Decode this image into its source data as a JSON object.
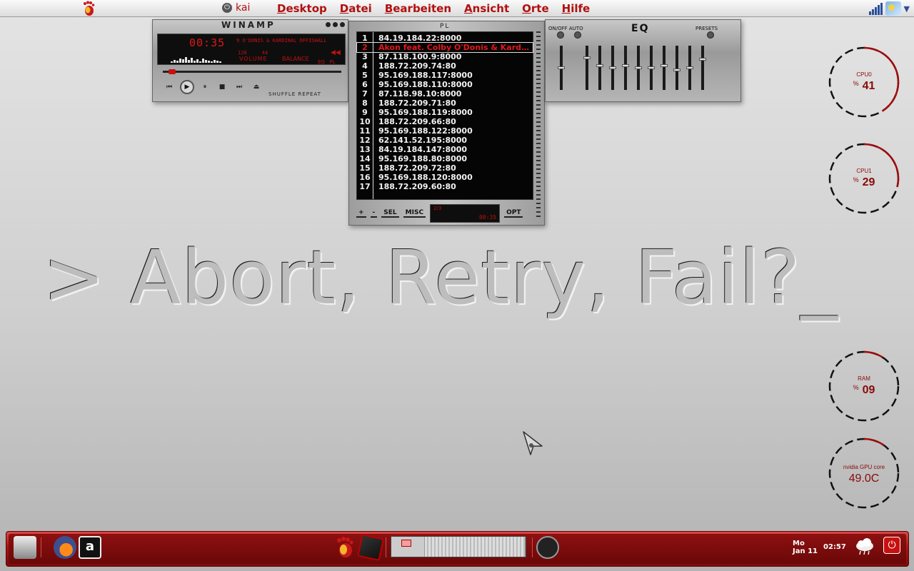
{
  "top_panel": {
    "user_name": "kai",
    "menus": [
      {
        "accel": "D",
        "rest": "esktop",
        "label": "Desktop"
      },
      {
        "accel": "D",
        "rest": "atei",
        "label": "Datei"
      },
      {
        "accel": "B",
        "rest": "earbeiten",
        "label": "Bearbeiten"
      },
      {
        "accel": "A",
        "rest": "nsicht",
        "label": "Ansicht"
      },
      {
        "accel": "O",
        "rest": "rte",
        "label": "Orte"
      },
      {
        "accel": "H",
        "rest": "ilfe",
        "label": "Hilfe"
      }
    ]
  },
  "winamp": {
    "logo": "WINAMP",
    "time": "00:35",
    "title": "9 O'DONIS & KARDINAL OFFISHALL",
    "kbps": "128",
    "khz": "44",
    "volume_label": "VOLUME",
    "balance_label": "BALANCE",
    "eq_label": "EQ",
    "pl_label": "PL",
    "shuffle_repeat": "SHUFFLE REPEAT"
  },
  "playlist": {
    "title": "PL",
    "current_index": 1,
    "items": [
      {
        "num": "1",
        "text": "84.19.184.22:8000"
      },
      {
        "num": "2",
        "text": "Akon feat. Colby O'Donis & Kardinal Offishall"
      },
      {
        "num": "3",
        "text": "87.118.100.9:8000"
      },
      {
        "num": "4",
        "text": "188.72.209.74:80"
      },
      {
        "num": "5",
        "text": "95.169.188.117:8000"
      },
      {
        "num": "6",
        "text": "95.169.188.110:8000"
      },
      {
        "num": "7",
        "text": "87.118.98.10:8000"
      },
      {
        "num": "8",
        "text": "188.72.209.71:80"
      },
      {
        "num": "9",
        "text": "95.169.188.119:8000"
      },
      {
        "num": "10",
        "text": "188.72.209.66:80"
      },
      {
        "num": "11",
        "text": "95.169.188.122:8000"
      },
      {
        "num": "12",
        "text": "62.141.52.195:8000"
      },
      {
        "num": "13",
        "text": "84.19.184.147:8000"
      },
      {
        "num": "14",
        "text": "95.169.188.80:8000"
      },
      {
        "num": "15",
        "text": "188.72.209.72:80"
      },
      {
        "num": "16",
        "text": "95.169.188.120:8000"
      },
      {
        "num": "17",
        "text": "188.72.209.60:80"
      }
    ],
    "buttons": {
      "add": "+",
      "remove": "-",
      "sel": "SEL",
      "misc": "MISC",
      "opt": "OPT"
    },
    "mini_count": "2/3",
    "mini_time": "00:35"
  },
  "equalizer": {
    "title": "EQ",
    "onoff_auto": "ON/OFF AUTO",
    "presets": "PRESETS",
    "preamp_level": 0.5,
    "band_levels": [
      0.75,
      0.55,
      0.5,
      0.55,
      0.5,
      0.5,
      0.55,
      0.45,
      0.5,
      0.7
    ]
  },
  "gauges": [
    {
      "label": "CPU0",
      "value": "41",
      "percent_sign": "%",
      "fill": 0.41
    },
    {
      "label": "CPU1",
      "value": "29",
      "percent_sign": "%",
      "fill": 0.29
    },
    {
      "label": "RAM",
      "value": "09",
      "percent_sign": "%",
      "fill": 0.09
    },
    {
      "label": "nvidia GPU core",
      "value": "49.0C",
      "percent_sign": "",
      "fill": 0.1
    }
  ],
  "desktop_text": "> Abort, Retry, Fail?_",
  "bottom_panel": {
    "clock_day": "Mo",
    "clock_date": "Jan 11",
    "clock_time": "02:57"
  },
  "colors": {
    "accent_red": "#b01010",
    "panel_red": "#a81616",
    "lcd_red": "#e01818"
  },
  "icons": [
    "gnome-foot-icon",
    "power-icon",
    "signal-icon",
    "weather-icon",
    "trash-icon",
    "firefox-icon",
    "amarok-icon",
    "notebook-icon",
    "speaker-icon",
    "cloud-icon",
    "shutdown-icon"
  ]
}
